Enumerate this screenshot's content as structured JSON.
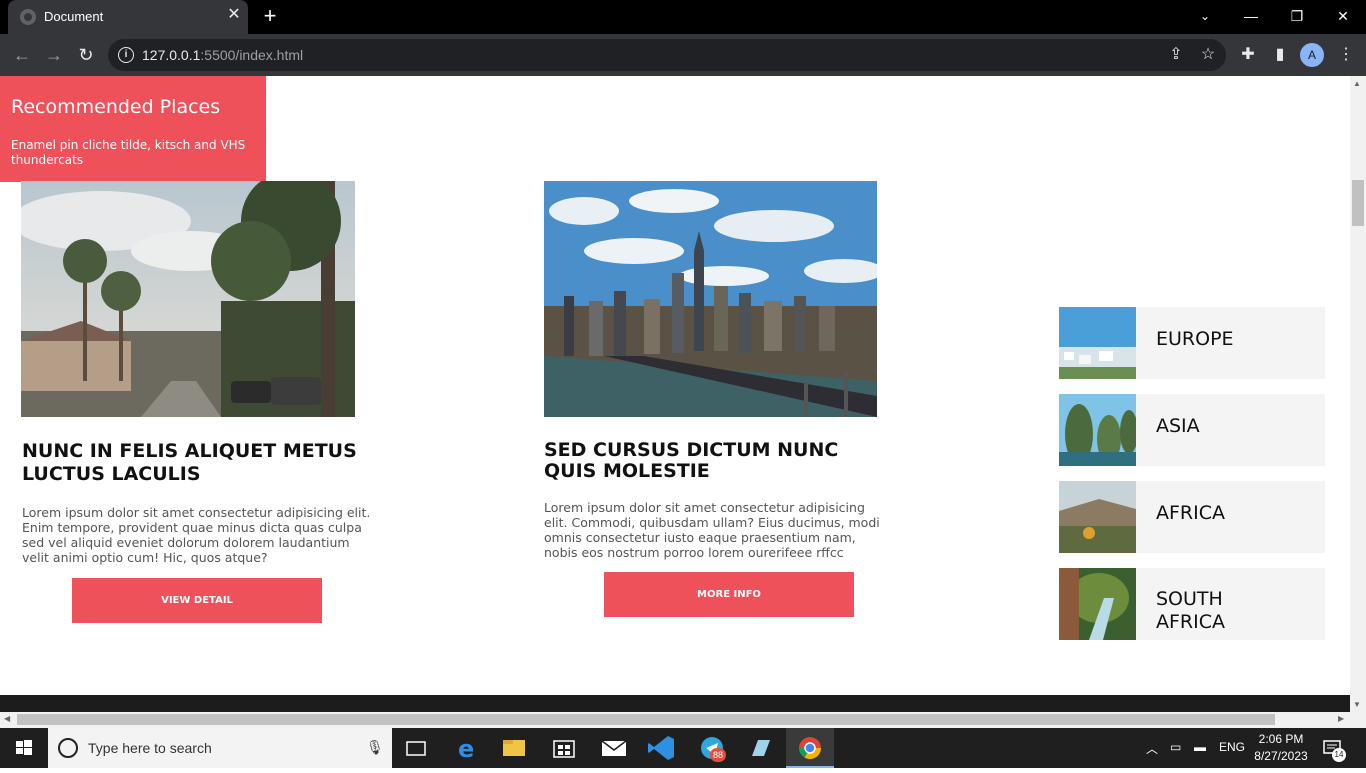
{
  "browser": {
    "tab_title": "Document",
    "url_host": "127.0.0.1",
    "url_path": ":5500/index.html",
    "avatar_letter": "A"
  },
  "cards": [
    {
      "title": "NUNC IN FELIS ALIQUET METUS LUCTUS LACULIS",
      "text": "Lorem ipsum dolor sit amet consectetur adipisicing elit. Enim tempore, provident quae minus dicta quas culpa sed vel aliquid eveniet dolorum dolorem laudantium velit animi optio cum! Hic, quos atque?",
      "button": "VIEW DETAIL"
    },
    {
      "title": "SED CURSUS DICTUM NUNC QUIS MOLESTIE",
      "text": "Lorem ipsum dolor sit amet consectetur adipisicing elit. Commodi, quibusdam ullam? Eius ducimus, modi omnis consectetur iusto eaque praesentium nam, nobis eos nostrum porroo lorem ourerifeee rffcc",
      "button": "MORE INFO"
    }
  ],
  "sidebar": {
    "heading": "Recommended Places",
    "subtext": "Enamel pin cliche tilde, kitsch and VHS thundercats",
    "places": [
      {
        "label": "EUROPE"
      },
      {
        "label": "ASIA"
      },
      {
        "label": "AFRICA"
      },
      {
        "label": "SOUTH AFRICA"
      }
    ]
  },
  "taskbar": {
    "search_placeholder": "Type here to search",
    "lang": "ENG",
    "time": "2:06 PM",
    "date": "8/27/2023",
    "telegram_badge": "88",
    "notif_count": "14"
  }
}
